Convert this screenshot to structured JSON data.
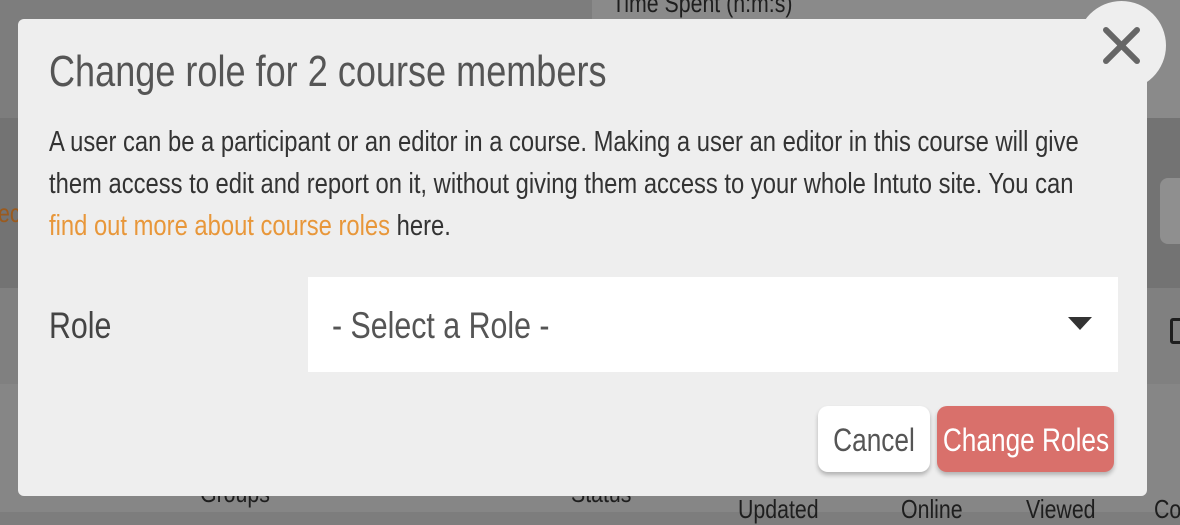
{
  "background": {
    "header_partial": "Time Spent (h:m:s)",
    "left_partial": "ect",
    "col_groups": "Groups",
    "col_status": "Status",
    "col_updated": "Updated",
    "col_online": "Online",
    "col_viewed": "Viewed",
    "col_partial": "Co"
  },
  "modal": {
    "title": "Change role for 2 course members",
    "description_pre": "A user can be a participant or an editor in a course. Making a user an editor in this course will give them access to edit and report on it, without giving them access to your whole Intuto site. You can ",
    "description_link": "find out more about course roles",
    "description_post": " here.",
    "role_label": "Role",
    "role_select_value": "- Select a Role -",
    "cancel_label": "Cancel",
    "submit_label": "Change Roles",
    "close_icon": "close-icon",
    "caret_icon": "chevron-down-icon"
  },
  "colors": {
    "accent_link": "#e8973a",
    "submit_button": "#d9706b",
    "modal_bg": "#eeeeee"
  }
}
